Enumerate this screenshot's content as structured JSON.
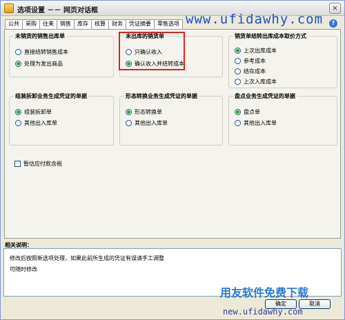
{
  "window": {
    "title": "选项设置 －－ 网页对话框",
    "close_label": "×"
  },
  "watermark_top": "www.ufidawhy.com",
  "tabs": [
    "公共",
    "采购",
    "往来",
    "销售",
    "库存",
    "核算",
    "财务",
    "凭证摘要",
    "零售选项"
  ],
  "help_label": "?",
  "groups": {
    "unsold_shipment": {
      "title": "未销货的销售出库单",
      "options": [
        "直接结转销售成本",
        "处理为发出商品"
      ],
      "selected": 1
    },
    "unshipped_sales": {
      "title": "未出库的销货单",
      "options": [
        "只确认收入",
        "确认收入并结转成本"
      ],
      "selected": 1
    },
    "cost_method": {
      "title": "销货单结转出库成本取价方式",
      "options": [
        "上次出库成本",
        "参考成本",
        "结存成本",
        "上次入库成本"
      ],
      "selected": 0
    },
    "assembly": {
      "title": "组装拆卸业务生成凭证的单据",
      "options": [
        "组装拆卸单",
        "其他出入库单"
      ],
      "selected": 0
    },
    "transform": {
      "title": "形态转换业务生成凭证的单据",
      "options": [
        "形态转换单",
        "其他出入库单"
      ],
      "selected": 0
    },
    "inventory_count": {
      "title": "盘点业务生成凭证的单据",
      "options": [
        "盘点单",
        "其他出入库单"
      ],
      "selected": 0
    }
  },
  "checkbox_tax": {
    "label": "暂估应付款含税",
    "checked": false
  },
  "description": {
    "label": "相关说明：",
    "lines": [
      "修改后按照新选项处理，如果此前所生成的凭证有误请手工调整",
      "可随时修改"
    ]
  },
  "buttons": {
    "ok": "确定",
    "cancel": "取消"
  },
  "watermark_bottom": {
    "line1": "用友软件免费下载",
    "line2": "new.ufidawhy.com"
  },
  "colors": {
    "highlight": "#e02020",
    "radio_selected": "#21a121"
  }
}
